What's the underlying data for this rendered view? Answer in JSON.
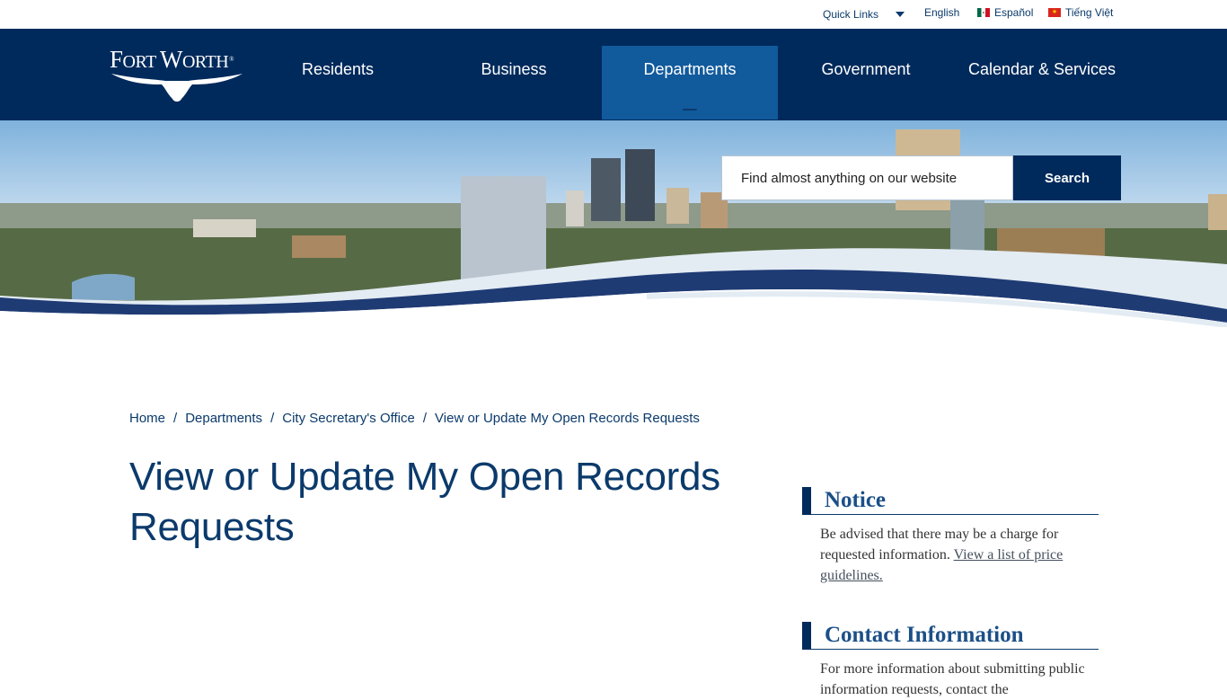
{
  "utility": {
    "quick_links": "Quick Links",
    "languages": [
      {
        "label": "English",
        "flag": ""
      },
      {
        "label": "Español",
        "flag": "mexico-flag"
      },
      {
        "label": "Tiếng Việt",
        "flag": "vietnam-flag"
      }
    ]
  },
  "logo": {
    "text_big_f": "F",
    "text_ort": "ORT ",
    "text_big_w": "W",
    "text_orth": "ORTH",
    "reg": "®",
    "alt": "Fort Worth"
  },
  "nav": {
    "items": [
      {
        "label": "Residents",
        "active": false
      },
      {
        "label": "Business",
        "active": false
      },
      {
        "label": "Departments",
        "active": true
      },
      {
        "label": "Government",
        "active": false
      },
      {
        "label": "Calendar & Services",
        "active": false
      }
    ]
  },
  "search": {
    "placeholder": "Find almost anything on our website",
    "button_label": "Search"
  },
  "breadcrumb": {
    "items": [
      "Home",
      "Departments",
      "City Secretary's Office",
      "View or Update My Open Records Requests"
    ],
    "separator": "/"
  },
  "page": {
    "title": "View or Update My Open Records Requests"
  },
  "sidebar": {
    "notice": {
      "title": "Notice",
      "text": "Be advised that there may be a charge for requested information.",
      "link": "View a list of price guidelines."
    },
    "contact": {
      "title": "Contact Information",
      "text": "For more information about submitting public information requests, contact the"
    }
  },
  "colors": {
    "navy": "#002a5c",
    "nav_active": "#115a9c",
    "text_blue": "#0b3a6b",
    "heading_blue": "#1b4f87"
  }
}
